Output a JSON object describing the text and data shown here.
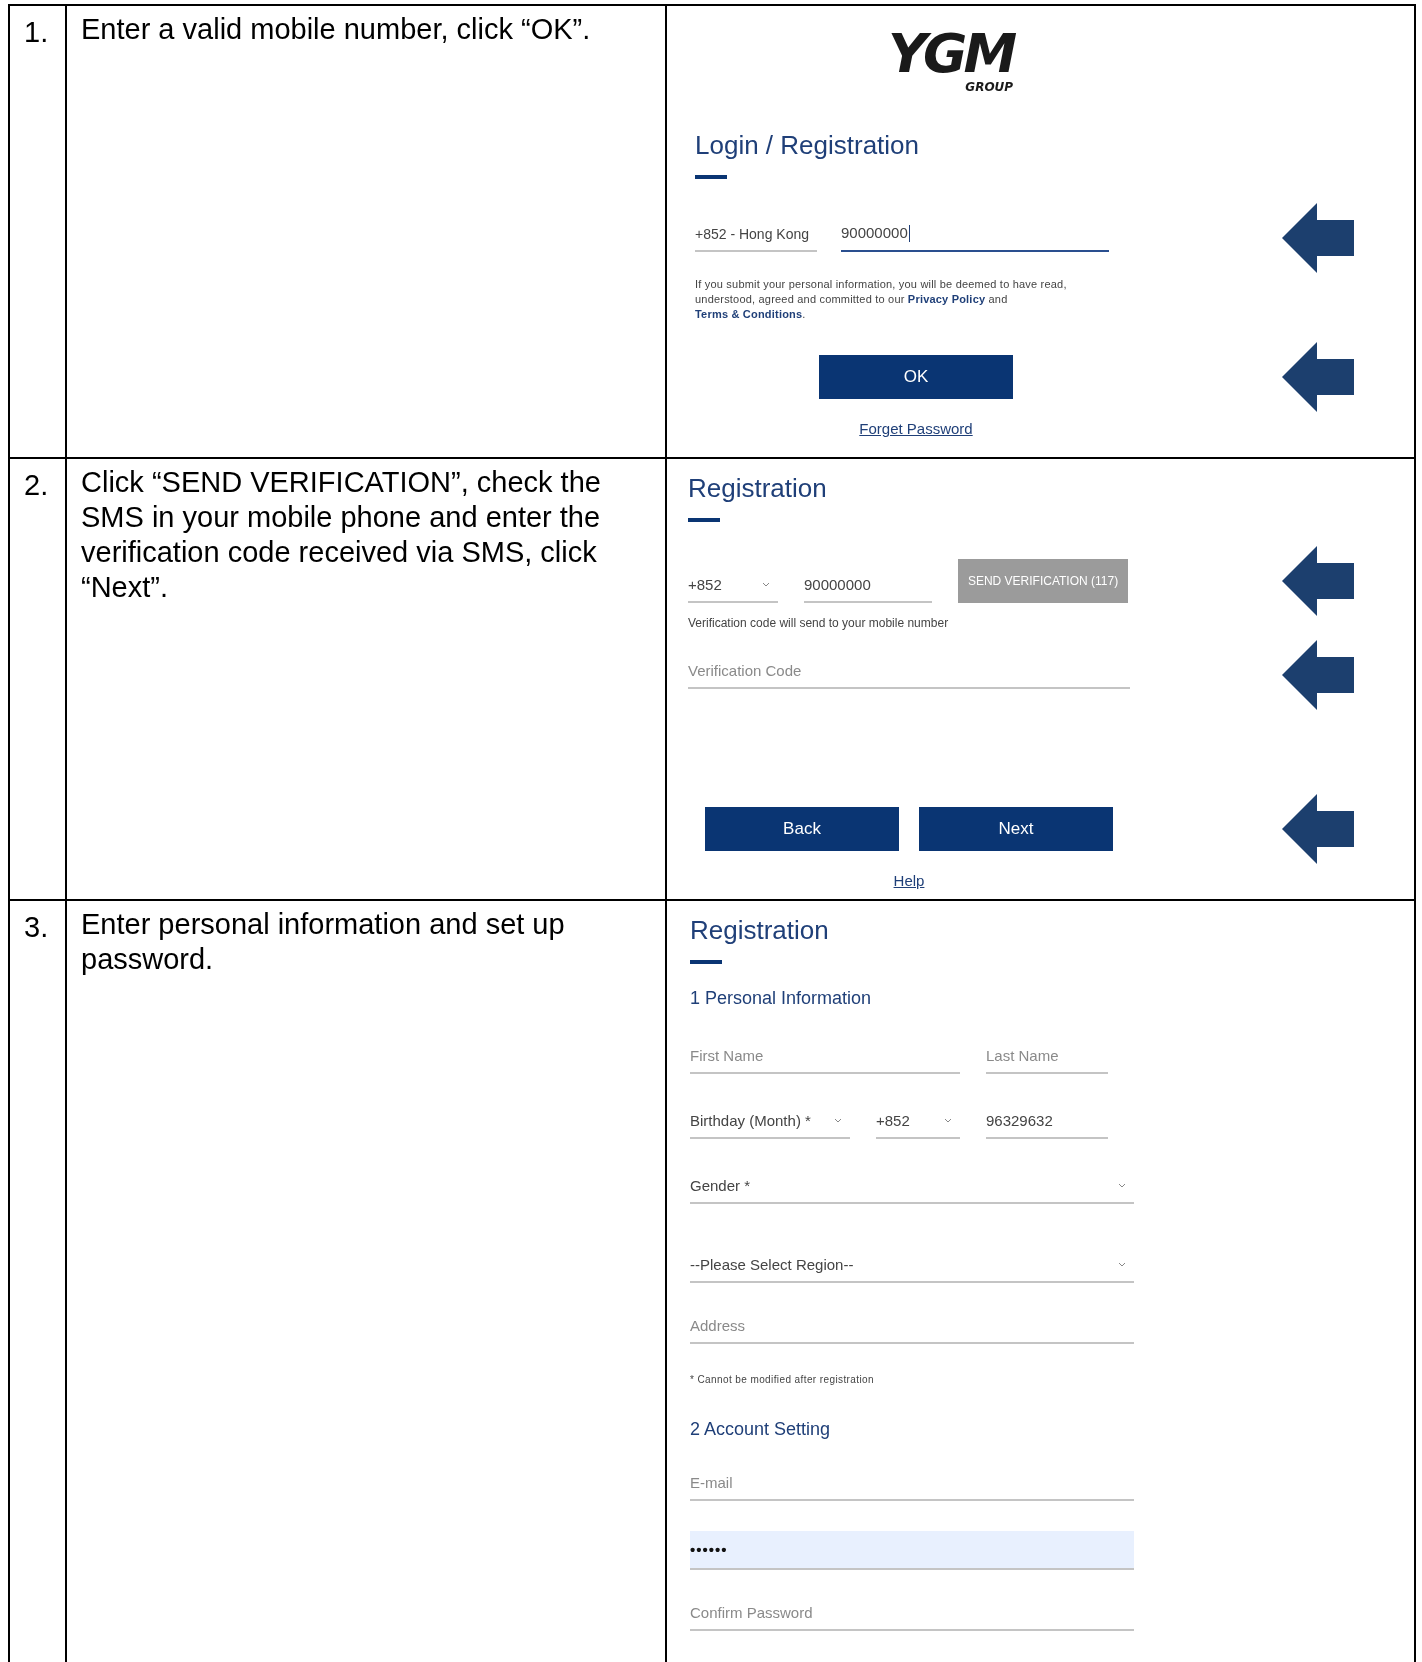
{
  "steps": [
    {
      "number": "1.",
      "instruction": "Enter a valid mobile number, click “OK”.",
      "screen": {
        "blocks": [
          {
            "kind": "logo",
            "mark": "YGM",
            "sub": "GROUP"
          },
          {
            "kind": "heading",
            "text": "Login / Registration"
          },
          {
            "kind": "phone",
            "pointer": true,
            "country": "+852 - Hong Kong",
            "number": "90000000",
            "focused": true
          },
          {
            "kind": "notice",
            "parts": [
              {
                "text": "If you submit your personal information, you will be deemed to have read, understood, agreed and committed to our "
              },
              {
                "link": "Privacy Policy"
              },
              {
                "text": " and "
              },
              {
                "link": "Terms & Conditions"
              },
              {
                "text": "."
              }
            ]
          },
          {
            "kind": "buttons",
            "pointer": true,
            "buttons": [
              "OK"
            ]
          },
          {
            "kind": "link",
            "text": "Forget Password"
          }
        ]
      }
    },
    {
      "number": "2.",
      "instruction": "Click “SEND VERIFICATION”, check the SMS in your mobile phone and enter the verification code received via SMS, click “Next”.",
      "screen": {
        "blocks": [
          {
            "kind": "heading",
            "text": "Registration"
          },
          {
            "kind": "phone-verify",
            "pointer": true,
            "country": "+852",
            "number": "90000000",
            "button": {
              "label": "SEND VERIFICATION (117)",
              "disabled": true
            }
          },
          {
            "kind": "hint",
            "text": "Verification code will send to your mobile number"
          },
          {
            "kind": "field",
            "pointer": true,
            "placeholder": "Verification Code"
          },
          {
            "kind": "buttons",
            "pointer": true,
            "buttons": [
              "Back",
              "Next"
            ]
          },
          {
            "kind": "link",
            "text": "Help"
          }
        ]
      }
    },
    {
      "number": "3.",
      "instruction": "Enter personal information and set up password.",
      "screen": {
        "blocks": [
          {
            "kind": "heading",
            "text": "Registration"
          },
          {
            "kind": "section",
            "text": "1 Personal Information"
          },
          {
            "kind": "name-row",
            "first": "First Name",
            "last": "Last Name"
          },
          {
            "kind": "birth-phone-row",
            "month": "Birthday (Month) *",
            "country": "+852",
            "number": "96329632"
          },
          {
            "kind": "select",
            "placeholder": "Gender *"
          },
          {
            "kind": "select",
            "placeholder": "--Please Select Region--"
          },
          {
            "kind": "field",
            "placeholder": "Address"
          },
          {
            "kind": "note",
            "text": "* Cannot be modified after registration"
          },
          {
            "kind": "section",
            "text": "2 Account Setting"
          },
          {
            "kind": "field",
            "placeholder": "E-mail"
          },
          {
            "kind": "password",
            "value": "••••••",
            "autofilled": true
          },
          {
            "kind": "field",
            "placeholder": "Confirm Password"
          }
        ]
      }
    }
  ]
}
